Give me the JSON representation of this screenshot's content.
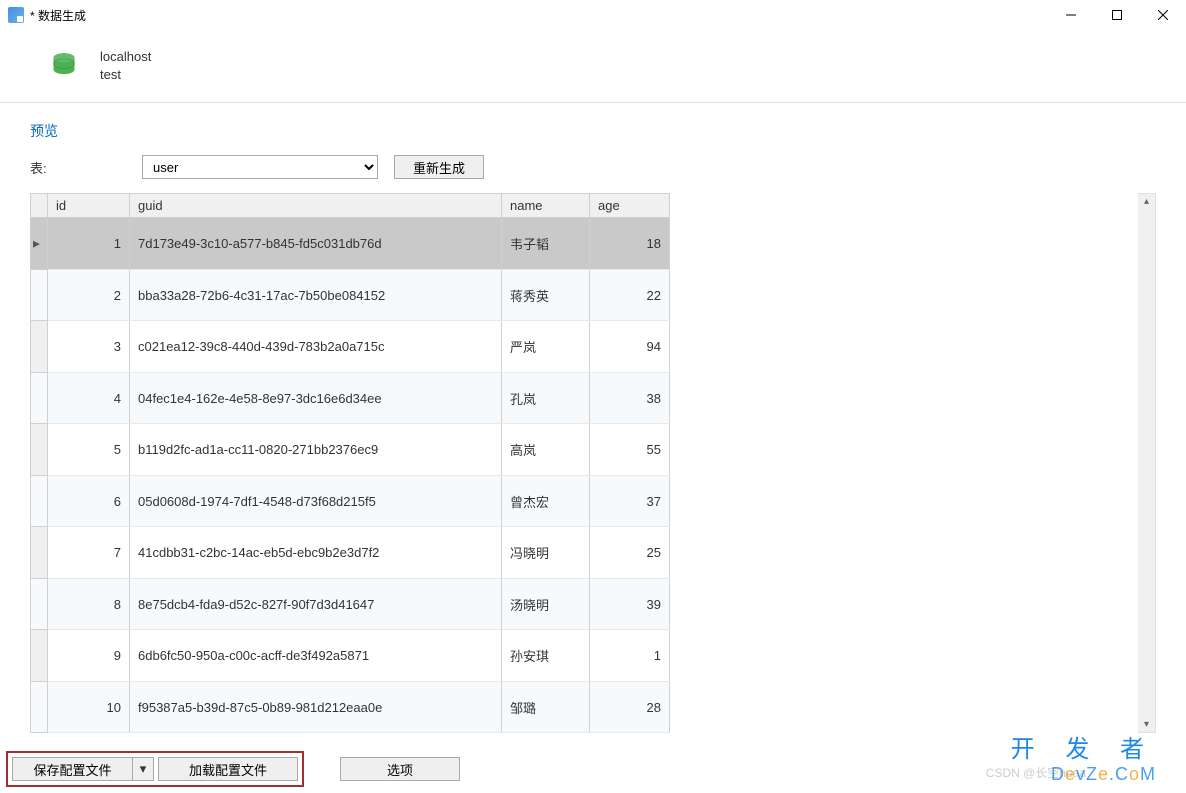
{
  "window": {
    "title": "* 数据生成"
  },
  "connection": {
    "host": "localhost",
    "db": "test"
  },
  "tabs": {
    "preview": "预览"
  },
  "tableRow": {
    "label": "表:",
    "selected": "user",
    "regenerate": "重新生成"
  },
  "grid": {
    "headers": {
      "id": "id",
      "guid": "guid",
      "name": "name",
      "age": "age"
    },
    "rows": [
      {
        "id": "1",
        "guid": "7d173e49-3c10-a577-b845-fd5c031db76d",
        "name": "韦子韬",
        "age": "18"
      },
      {
        "id": "2",
        "guid": "bba33a28-72b6-4c31-17ac-7b50be084152",
        "name": "蒋秀英",
        "age": "22"
      },
      {
        "id": "3",
        "guid": "c021ea12-39c8-440d-439d-783b2a0a715c",
        "name": "严岚",
        "age": "94"
      },
      {
        "id": "4",
        "guid": "04fec1e4-162e-4e58-8e97-3dc16e6d34ee",
        "name": "孔岚",
        "age": "38"
      },
      {
        "id": "5",
        "guid": "b119d2fc-ad1a-cc11-0820-271bb2376ec9",
        "name": "高岚",
        "age": "55"
      },
      {
        "id": "6",
        "guid": "05d0608d-1974-7df1-4548-d73f68d215f5",
        "name": "曾杰宏",
        "age": "37"
      },
      {
        "id": "7",
        "guid": "41cdbb31-c2bc-14ac-eb5d-ebc9b2e3d7f2",
        "name": "冯晓明",
        "age": "25"
      },
      {
        "id": "8",
        "guid": "8e75dcb4-fda9-d52c-827f-90f7d3d41647",
        "name": "汤晓明",
        "age": "39"
      },
      {
        "id": "9",
        "guid": "6db6fc50-950a-c00c-acff-de3f492a5871",
        "name": "孙安琪",
        "age": "1"
      },
      {
        "id": "10",
        "guid": "f95387a5-b39d-87c5-0b89-981d212eaa0e",
        "name": "邹璐",
        "age": "28"
      }
    ]
  },
  "bottom": {
    "save": "保存配置文件",
    "load": "加载配置文件",
    "options": "选项",
    "csdn": "CSDN @长空nuaa",
    "wm_top": "开 发 者",
    "wm_bottom_pre": "D",
    "wm_bottom_mid": "e",
    "wm_bottom_post": "vZ",
    "wm_bottom_mid2": "e",
    "wm_bottom_tail": ".C",
    "wm_bottom_o": "o",
    "wm_bottom_m": "M"
  }
}
